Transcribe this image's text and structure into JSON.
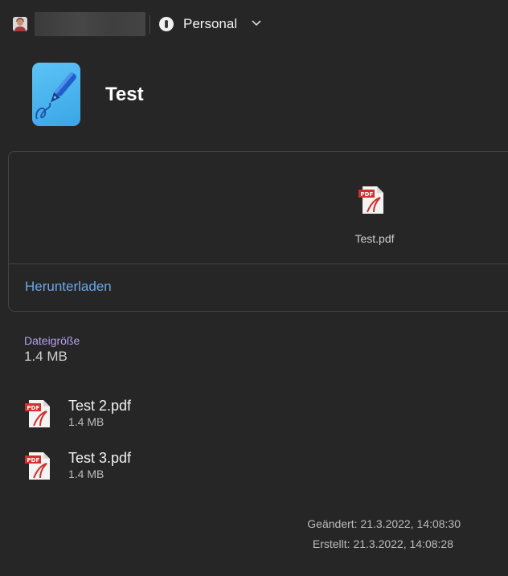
{
  "header": {
    "vault_name": "Personal"
  },
  "item": {
    "title": "Test"
  },
  "attachment": {
    "preview_name": "Test.pdf",
    "download_label": "Herunterladen",
    "size_label": "Dateigröße",
    "size_value": "1.4 MB"
  },
  "files": [
    {
      "name": "Test 2.pdf",
      "size": "1.4 MB",
      "icon": "pdf-file-icon"
    },
    {
      "name": "Test 3.pdf",
      "size": "1.4 MB",
      "icon": "pdf-file-icon"
    }
  ],
  "meta": {
    "modified": "Geändert: 21.3.2022, 14:08:30",
    "created": "Erstellt: 21.3.2022, 14:08:28"
  },
  "colors": {
    "background": "#262626",
    "link": "#6aa8ea",
    "label_accent": "#b6a1ef",
    "app_icon": "#3aa6e6"
  }
}
